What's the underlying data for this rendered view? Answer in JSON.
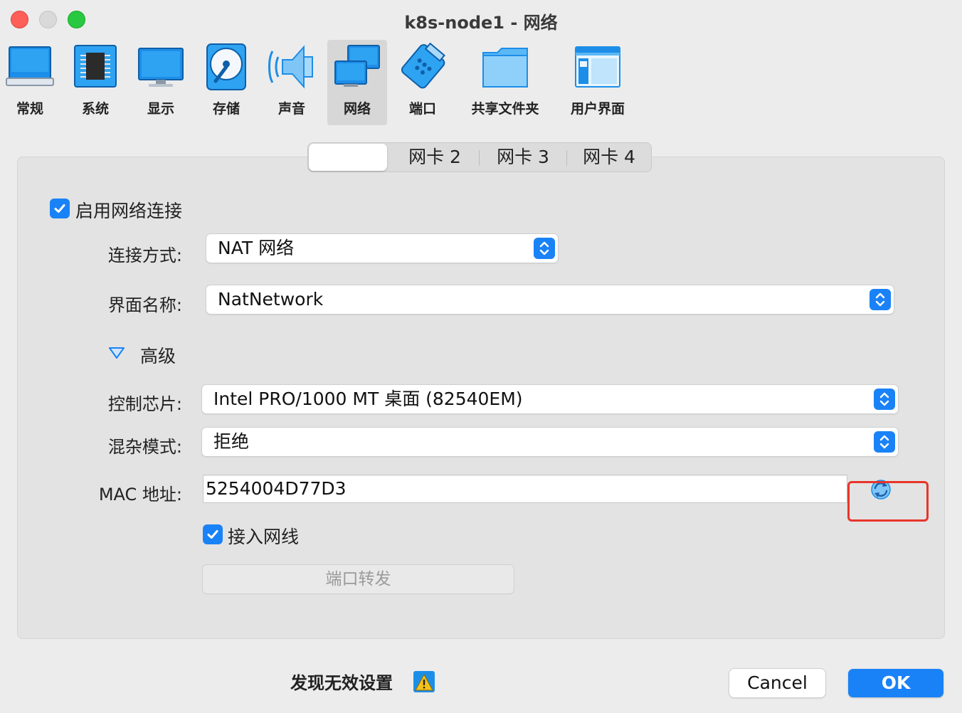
{
  "window": {
    "title": "k8s-node1 - 网络"
  },
  "toolbar": {
    "items": [
      {
        "label": "常规",
        "icon": "general-icon"
      },
      {
        "label": "系统",
        "icon": "system-chip-icon"
      },
      {
        "label": "显示",
        "icon": "display-icon"
      },
      {
        "label": "存储",
        "icon": "storage-disk-icon"
      },
      {
        "label": "声音",
        "icon": "speaker-icon"
      },
      {
        "label": "网络",
        "icon": "network-icon",
        "active": true
      },
      {
        "label": "端口",
        "icon": "serial-port-icon"
      },
      {
        "label": "共享文件夹",
        "icon": "shared-folder-icon"
      },
      {
        "label": "用户界面",
        "icon": "user-interface-icon"
      }
    ]
  },
  "tabs": [
    {
      "label": "",
      "selected": true
    },
    {
      "label": "网卡 2"
    },
    {
      "label": "网卡 3"
    },
    {
      "label": "网卡 4"
    }
  ],
  "form": {
    "enable_network": {
      "label": "启用网络连接",
      "checked": true
    },
    "attached_to": {
      "label": "连接方式:",
      "value": "NAT 网络"
    },
    "interface_name": {
      "label": "界面名称:",
      "value": "NatNetwork"
    },
    "advanced": {
      "label": "高级"
    },
    "adapter_type": {
      "label": "控制芯片:",
      "value": "Intel PRO/1000 MT 桌面 (82540EM)"
    },
    "promiscuous_mode": {
      "label": "混杂模式:",
      "value": "拒绝"
    },
    "mac_address": {
      "label": "MAC 地址:",
      "value": "5254004D77D3"
    },
    "cable_connected": {
      "label": "接入网线",
      "checked": true
    },
    "port_forwarding": {
      "label": "端口转发"
    }
  },
  "footer": {
    "warning": "发现无效设置",
    "cancel": "Cancel",
    "ok": "OK"
  },
  "colors": {
    "accent": "#1a82f7",
    "highlight_box": "#e8352a"
  }
}
